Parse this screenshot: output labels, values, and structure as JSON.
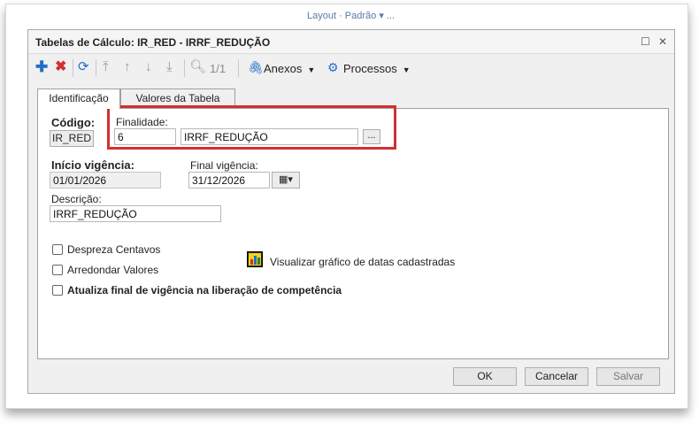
{
  "background_strip": "Layout · Padrão ▾ ...",
  "dialog": {
    "title": "Tabelas de Cálculo: IR_RED - IRRF_REDUÇÃO",
    "minimize": "☐",
    "close": "✕"
  },
  "toolbar": {
    "page_indicator": "1/1",
    "anexos_label": "Anexos",
    "processos_label": "Processos"
  },
  "tabs": [
    {
      "label": "Identificação",
      "active": true
    },
    {
      "label": "Valores da Tabela",
      "active": false
    }
  ],
  "form": {
    "codigo_label": "Código:",
    "codigo_value": "IR_RED",
    "finalidade_label": "Finalidade:",
    "finalidade_code": "6",
    "finalidade_desc": "IRRF_REDUÇÃO",
    "lookup_button": "...",
    "inicio_label": "Início vigência:",
    "inicio_value": "01/01/2026",
    "final_label": "Final vigência:",
    "final_value": "31/12/2026",
    "descricao_label": "Descrição:",
    "descricao_value": "IRRF_REDUÇÃO"
  },
  "options": {
    "despreza_centavos": {
      "label": "Despreza Centavos",
      "checked": false
    },
    "arredondar_valores": {
      "label": "Arredondar Valores",
      "checked": false
    },
    "atualiza_final": {
      "label": "Atualiza final de vigência na liberação de competência",
      "checked": false
    },
    "grafico_link": "Visualizar gráfico de datas cadastradas"
  },
  "footer": {
    "ok": "OK",
    "cancelar": "Cancelar",
    "salvar": "Salvar"
  },
  "colors": {
    "highlight": "#d32f2f",
    "accent_blue": "#1f6fc5",
    "delete_red": "#d32f2f"
  }
}
